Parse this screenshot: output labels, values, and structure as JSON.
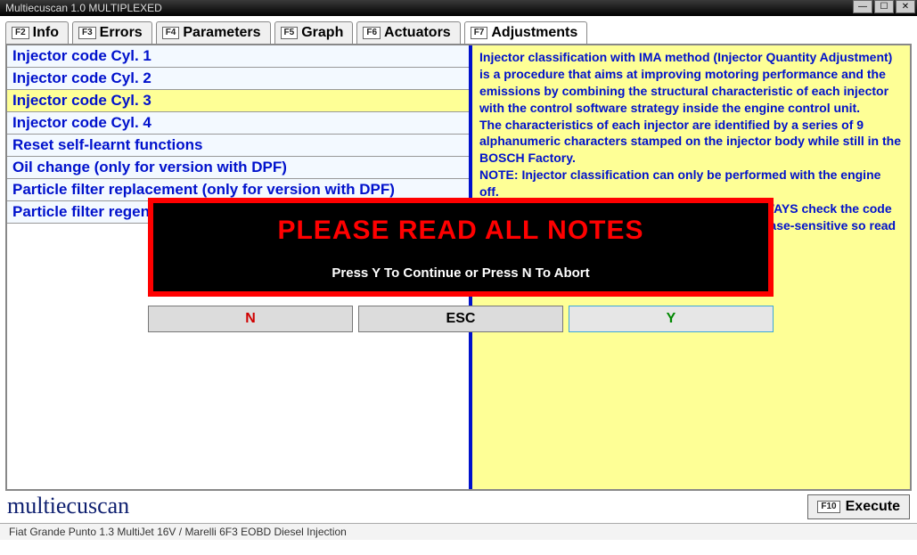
{
  "window": {
    "title": "Multiecuscan 1.0 MULTIPLEXED"
  },
  "tabs": [
    {
      "fkey": "F2",
      "label": "Info"
    },
    {
      "fkey": "F3",
      "label": "Errors"
    },
    {
      "fkey": "F4",
      "label": "Parameters"
    },
    {
      "fkey": "F5",
      "label": "Graph"
    },
    {
      "fkey": "F6",
      "label": "Actuators"
    },
    {
      "fkey": "F7",
      "label": "Adjustments"
    }
  ],
  "active_tab": 5,
  "adjustments": [
    "Injector code Cyl. 1",
    "Injector code Cyl. 2",
    "Injector code Cyl. 3",
    "Injector code Cyl. 4",
    "Reset self-learnt functions",
    "Oil change (only for version with DPF)",
    "Particle filter replacement (only for version with DPF)",
    "Particle filter regeneration"
  ],
  "selected_adjustment": 2,
  "info_panel": "Injector classification with IMA method (Injector Quantity Adjustment) is a procedure that aims at improving motoring performance and the emissions by combining the structural characteristic of each injector with the control software strategy inside the engine control unit.\nThe characteristics of each injector are identified by a series of 9 alphanumeric characters stamped on the injector body while still in the BOSCH Factory.\nNOTE: Injector classification can only be performed with the engine off.\nBefore executing this procedure you have to ALWAYS check the code stamped on the injector (ALWAYS). The code is case-sensitive so read carefully before the procedure.",
  "modal": {
    "title": "PLEASE READ ALL NOTES",
    "subtitle": "Press Y To Continue or Press N To Abort",
    "buttons": {
      "n": "N",
      "esc": "ESC",
      "y": "Y"
    }
  },
  "brand": "multiecuscan",
  "execute": {
    "fkey": "F10",
    "label": "Execute"
  },
  "statusbar": "Fiat Grande Punto 1.3 MultiJet 16V / Marelli 6F3 EOBD Diesel Injection"
}
